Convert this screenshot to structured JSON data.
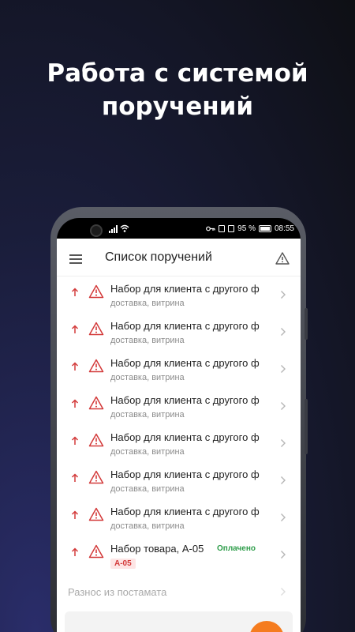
{
  "promo": {
    "headline_line1": "Работа с системой",
    "headline_line2": "поручений"
  },
  "statusbar": {
    "battery_percent": "95 %",
    "time": "08:55"
  },
  "appbar": {
    "title": "Список поручений"
  },
  "tasks": [
    {
      "title": "Набор для клиента с другого ф",
      "subtitle": "доставка, витрина"
    },
    {
      "title": "Набор для клиента с другого ф",
      "subtitle": "доставка, витрина"
    },
    {
      "title": "Набор для клиента с другого ф",
      "subtitle": "доставка, витрина"
    },
    {
      "title": "Набор для клиента с другого ф",
      "subtitle": "доставка, витрина"
    },
    {
      "title": "Набор для клиента с другого ф",
      "subtitle": "доставка, витрина"
    },
    {
      "title": "Набор для клиента с другого ф",
      "subtitle": "доставка, витрина"
    },
    {
      "title": "Набор для клиента с другого ф",
      "subtitle": "доставка, витрина"
    }
  ],
  "order_task": {
    "title": "Набор товара, А-05",
    "status": "Оплачено",
    "code": "А-05"
  },
  "muted_task": {
    "title": "Разнос из постамата"
  },
  "colors": {
    "accent": "#f57c1f",
    "warning": "#d33a3a",
    "paid": "#2e9d4a"
  }
}
